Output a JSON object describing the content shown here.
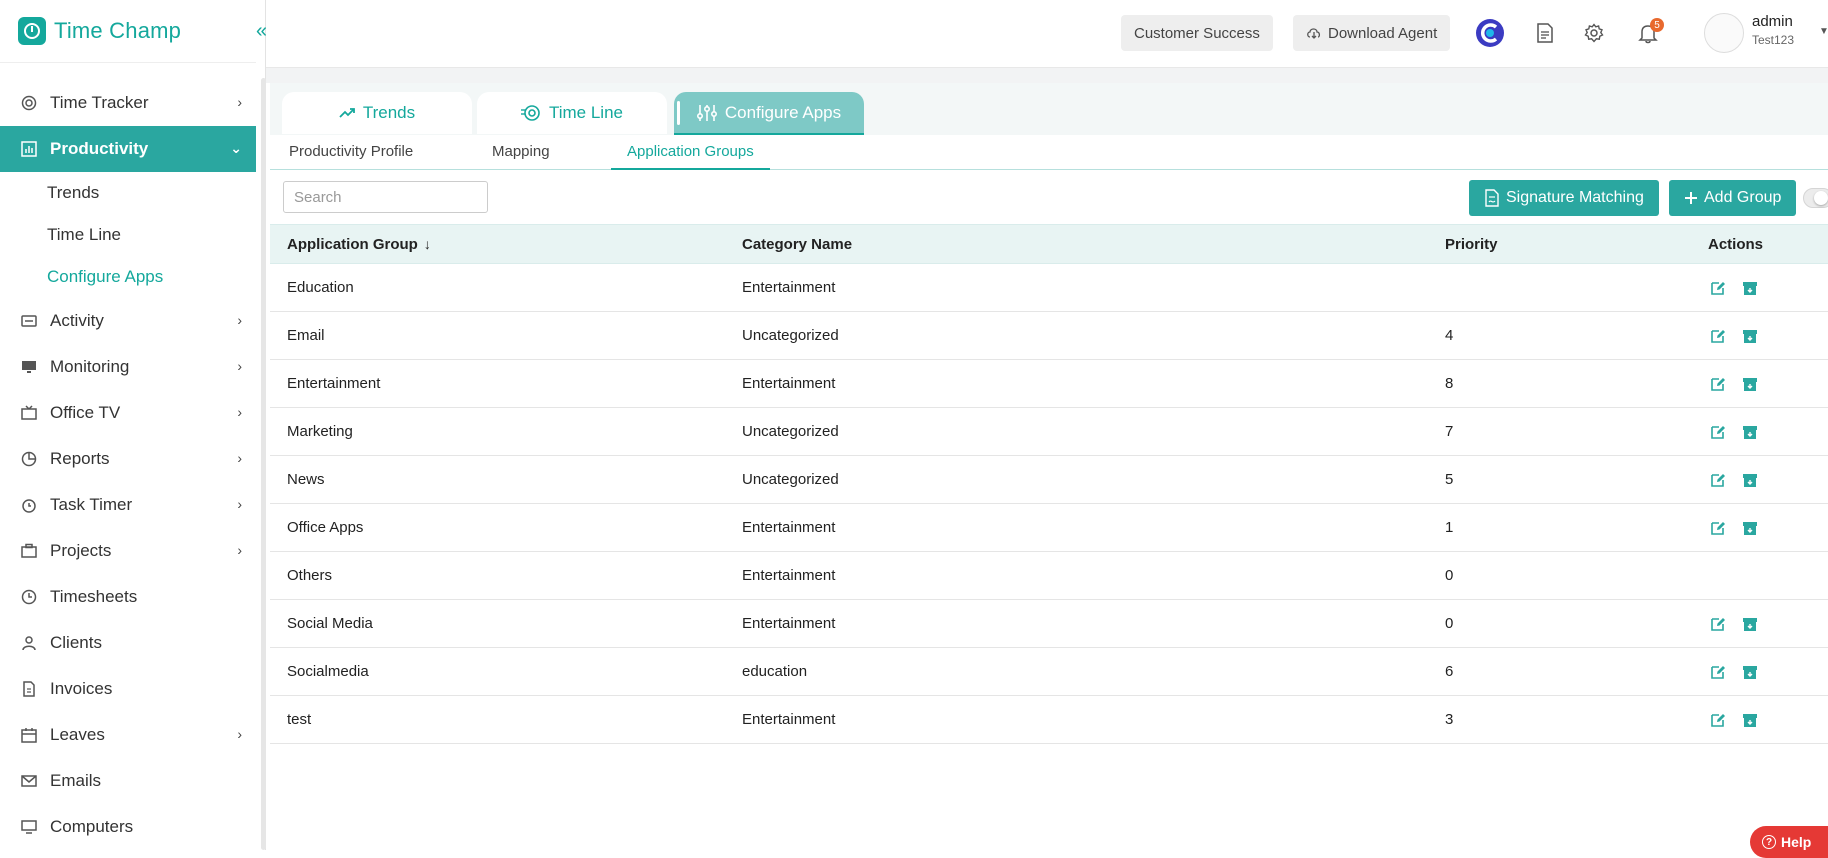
{
  "brand": {
    "name": "Time Champ",
    "collapse_label": "«"
  },
  "sidebar": {
    "items": [
      {
        "label": "Time Tracker",
        "icon": "time-tracker-icon",
        "has_chevron": true
      },
      {
        "label": "Productivity",
        "icon": "productivity-chart-icon",
        "has_chevron": true,
        "active": true
      },
      {
        "label": "Activity",
        "icon": "activity-icon",
        "has_chevron": true
      },
      {
        "label": "Monitoring",
        "icon": "monitor-icon",
        "has_chevron": true
      },
      {
        "label": "Office TV",
        "icon": "tv-icon",
        "has_chevron": true
      },
      {
        "label": "Reports",
        "icon": "pie-chart-icon",
        "has_chevron": true
      },
      {
        "label": "Task Timer",
        "icon": "alarm-icon",
        "has_chevron": true
      },
      {
        "label": "Projects",
        "icon": "briefcase-icon",
        "has_chevron": true
      },
      {
        "label": "Timesheets",
        "icon": "clock-icon",
        "has_chevron": false
      },
      {
        "label": "Clients",
        "icon": "user-icon",
        "has_chevron": false
      },
      {
        "label": "Invoices",
        "icon": "invoice-icon",
        "has_chevron": false
      },
      {
        "label": "Leaves",
        "icon": "calendar-icon",
        "has_chevron": true
      },
      {
        "label": "Emails",
        "icon": "mail-icon",
        "has_chevron": false
      },
      {
        "label": "Computers",
        "icon": "computer-icon",
        "has_chevron": false
      }
    ],
    "productivity_sub": [
      "Trends",
      "Time Line",
      "Configure Apps"
    ]
  },
  "header": {
    "customer_success": "Customer Success",
    "download_agent": "Download Agent",
    "notification_count": "5",
    "user_name": "admin",
    "user_org": "Test123"
  },
  "tabs": {
    "main": [
      "Trends",
      "Time Line",
      "Configure Apps"
    ],
    "sub": [
      "Productivity Profile",
      "Mapping",
      "Application Groups"
    ]
  },
  "toolbar": {
    "search_placeholder": "Search",
    "signature_matching": "Signature Matching",
    "add_group": "Add Group"
  },
  "table": {
    "headers": {
      "group": "Application Group",
      "category": "Category Name",
      "priority": "Priority",
      "actions": "Actions"
    },
    "rows": [
      {
        "group": "Education",
        "category": "Entertainment",
        "priority": "",
        "actions": true
      },
      {
        "group": "Email",
        "category": "Uncategorized",
        "priority": "4",
        "actions": true
      },
      {
        "group": "Entertainment",
        "category": "Entertainment",
        "priority": "8",
        "actions": true
      },
      {
        "group": "Marketing",
        "category": "Uncategorized",
        "priority": "7",
        "actions": true
      },
      {
        "group": "News",
        "category": "Uncategorized",
        "priority": "5",
        "actions": true
      },
      {
        "group": "Office Apps",
        "category": "Entertainment",
        "priority": "1",
        "actions": true
      },
      {
        "group": "Others",
        "category": "Entertainment",
        "priority": "0",
        "actions": false
      },
      {
        "group": "Social Media",
        "category": "Entertainment",
        "priority": "0",
        "actions": true
      },
      {
        "group": "Socialmedia",
        "category": "education",
        "priority": "6",
        "actions": true
      },
      {
        "group": "test",
        "category": "Entertainment",
        "priority": "3",
        "actions": true
      }
    ]
  },
  "help": {
    "label": "Help"
  },
  "colors": {
    "accent": "#14a89c",
    "active_nav": "#2aa7a0",
    "badge": "#e8692e",
    "help": "#e53935"
  }
}
